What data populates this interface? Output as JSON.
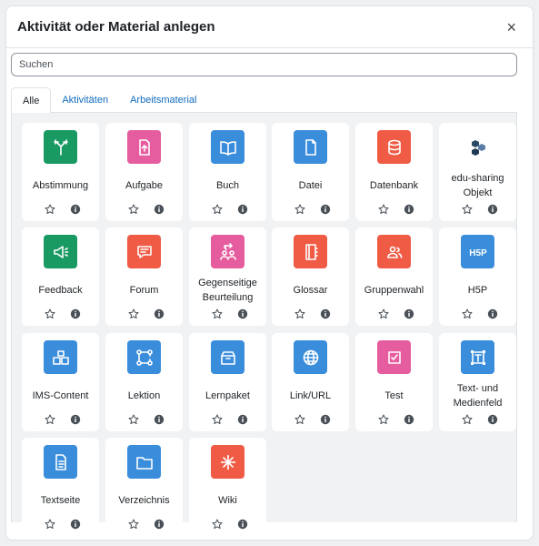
{
  "modal": {
    "title": "Aktivität oder Material anlegen",
    "close_label": "×"
  },
  "search": {
    "placeholder": "Suchen"
  },
  "tabs": [
    {
      "label": "Alle",
      "active": true
    },
    {
      "label": "Aktivitäten",
      "active": false
    },
    {
      "label": "Arbeitsmaterial",
      "active": false
    }
  ],
  "items": [
    {
      "name": "Abstimmung",
      "icon": "choice-icon",
      "color": "#1a9a63"
    },
    {
      "name": "Aufgabe",
      "icon": "assignment-icon",
      "color": "#e55d9e"
    },
    {
      "name": "Buch",
      "icon": "book-icon",
      "color": "#3a8ddb"
    },
    {
      "name": "Datei",
      "icon": "file-icon",
      "color": "#3a8ddb"
    },
    {
      "name": "Datenbank",
      "icon": "database-icon",
      "color": "#ef5b45"
    },
    {
      "name": "edu-sharing Objekt",
      "icon": "edu-sharing-icon",
      "color": "#2b4a66"
    },
    {
      "name": "Feedback",
      "icon": "feedback-icon",
      "color": "#1a9a63"
    },
    {
      "name": "Forum",
      "icon": "forum-icon",
      "color": "#ef5b45"
    },
    {
      "name": "Gegenseitige Beurteilung",
      "icon": "workshop-icon",
      "color": "#e55d9e"
    },
    {
      "name": "Glossar",
      "icon": "glossary-icon",
      "color": "#ef5b45"
    },
    {
      "name": "Gruppenwahl",
      "icon": "group-choice-icon",
      "color": "#ef5b45"
    },
    {
      "name": "H5P",
      "icon": "h5p-icon",
      "color": "#3a8ddb"
    },
    {
      "name": "IMS-Content",
      "icon": "ims-content-icon",
      "color": "#3a8ddb"
    },
    {
      "name": "Lektion",
      "icon": "lesson-icon",
      "color": "#3a8ddb"
    },
    {
      "name": "Lernpaket",
      "icon": "scorm-package-icon",
      "color": "#3a8ddb"
    },
    {
      "name": "Link/URL",
      "icon": "globe-icon",
      "color": "#3a8ddb"
    },
    {
      "name": "Test",
      "icon": "quiz-icon",
      "color": "#e55d9e"
    },
    {
      "name": "Text- und Medienfeld",
      "icon": "text-media-icon",
      "color": "#3a8ddb"
    },
    {
      "name": "Textseite",
      "icon": "page-icon",
      "color": "#3a8ddb"
    },
    {
      "name": "Verzeichnis",
      "icon": "folder-icon",
      "color": "#3a8ddb"
    },
    {
      "name": "Wiki",
      "icon": "wiki-icon",
      "color": "#ef5b45"
    }
  ],
  "item_actions": {
    "star_icon": "star-outline-icon",
    "info_icon": "info-icon"
  }
}
